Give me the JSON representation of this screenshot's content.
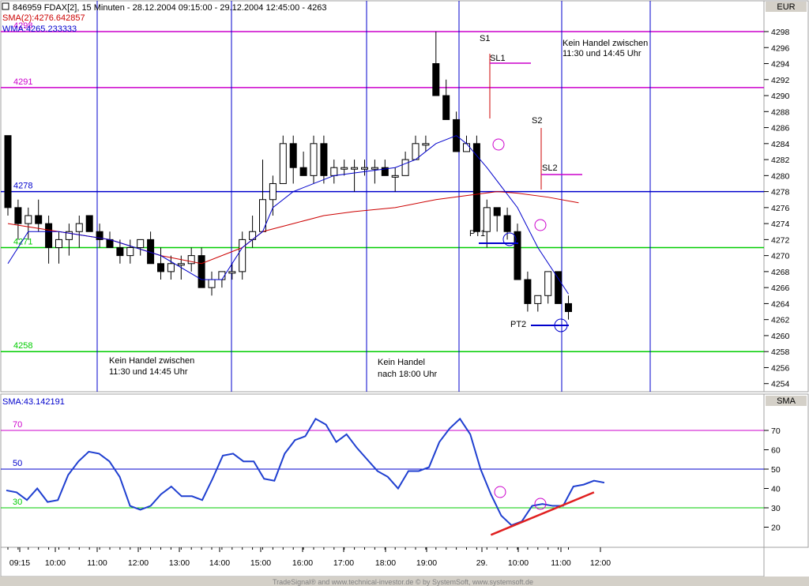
{
  "header": {
    "info": "846959  FDAX[2], 15 Minuten - 28.12.2004 09:15:00 - 29.12.2004 12:45:00 - 4263",
    "sma_line": "SMA(2):4276.642857",
    "wma_line": "WMA:4265.233333",
    "currency": "EUR"
  },
  "lower_panel": {
    "title": "SMA:43.142191",
    "right_label": "SMA"
  },
  "footer": "TradeSignal® and www.technical-investor.de © by SystemSoft, www.systemsoft.de",
  "colors": {
    "magenta": "#cc00cc",
    "blue": "#0000cc",
    "green": "#00cc00",
    "red": "#cc0000",
    "indicator": "#1f3fd0",
    "trend": "#e02020"
  },
  "chart_data": [
    {
      "type": "candlestick",
      "y_axis_ticks": [
        4254,
        4256,
        4258,
        4260,
        4262,
        4264,
        4266,
        4268,
        4270,
        4272,
        4274,
        4276,
        4278,
        4280,
        4282,
        4284,
        4286,
        4288,
        4290,
        4292,
        4294,
        4296,
        4298
      ],
      "ylim": [
        4253,
        4300
      ],
      "x_tick_labels": [
        "09:15",
        "10:00",
        "11:00",
        "12:00",
        "13:00",
        "14:00",
        "15:00",
        "16:00",
        "17:00",
        "18:00",
        "19:00",
        "29.",
        "10:00",
        "11:00",
        "12:00"
      ],
      "horizontal_levels": [
        {
          "value": 4298,
          "label": "4298",
          "color": "#cc00cc"
        },
        {
          "value": 4291,
          "label": "4291",
          "color": "#cc00cc"
        },
        {
          "value": 4278,
          "label": "4278",
          "color": "#0000cc"
        },
        {
          "value": 4271,
          "label": "4271",
          "color": "#00cc00"
        },
        {
          "value": 4258,
          "label": "4258",
          "color": "#00cc00"
        }
      ],
      "candles": [
        [
          4285,
          4285,
          4275,
          4276
        ],
        [
          4276,
          4277,
          4272,
          4274
        ],
        [
          4274,
          4276,
          4272,
          4275
        ],
        [
          4275,
          4277,
          4273,
          4274
        ],
        [
          4274,
          4275,
          4269,
          4271
        ],
        [
          4271,
          4273,
          4269,
          4272
        ],
        [
          4272,
          4274,
          4270,
          4273
        ],
        [
          4273,
          4275,
          4271,
          4274
        ],
        [
          4275,
          4275,
          4273,
          4273
        ],
        [
          4273,
          4274,
          4271,
          4272
        ],
        [
          4272,
          4273,
          4271,
          4271
        ],
        [
          4271,
          4272,
          4269,
          4270
        ],
        [
          4270,
          4272,
          4269,
          4271
        ],
        [
          4271,
          4272,
          4270,
          4272
        ],
        [
          4272,
          4273,
          4270,
          4269
        ],
        [
          4269,
          4271,
          4267,
          4268
        ],
        [
          4268,
          4270,
          4267,
          4269
        ],
        [
          4269,
          4270,
          4267,
          4269
        ],
        [
          4269,
          4271,
          4268,
          4270
        ],
        [
          4270,
          4271,
          4266,
          4266
        ],
        [
          4266,
          4268,
          4265,
          4267
        ],
        [
          4267,
          4268,
          4266,
          4268
        ],
        [
          4268,
          4269,
          4267,
          4268
        ],
        [
          4268,
          4273,
          4267,
          4272
        ],
        [
          4272,
          4275,
          4271,
          4273
        ],
        [
          4273,
          4282,
          4273,
          4277
        ],
        [
          4277,
          4280,
          4275,
          4279
        ],
        [
          4279,
          4285,
          4279,
          4284
        ],
        [
          4284,
          4285,
          4279,
          4281
        ],
        [
          4281,
          4283,
          4280,
          4280
        ],
        [
          4280,
          4285,
          4279,
          4284
        ],
        [
          4284,
          4285,
          4279,
          4280
        ],
        [
          4280,
          4282,
          4279,
          4281
        ],
        [
          4281,
          4282,
          4280,
          4281
        ],
        [
          4281,
          4282,
          4278,
          4281
        ],
        [
          4281,
          4282,
          4280,
          4281
        ],
        [
          4281,
          4282,
          4279,
          4281
        ],
        [
          4281,
          4282,
          4280,
          4280
        ],
        [
          4280,
          4281,
          4278,
          4280
        ],
        [
          4280,
          4283,
          4280,
          4282
        ],
        [
          4282,
          4285,
          4282,
          4284
        ],
        [
          4284,
          4285,
          4283,
          4284
        ],
        [
          4294,
          4298,
          4290,
          4290
        ],
        [
          4290,
          4292,
          4288,
          4287
        ],
        [
          4287,
          4288,
          4284,
          4283
        ],
        [
          4283,
          4285,
          4283,
          4284
        ],
        [
          4284,
          4285,
          4273,
          4273
        ],
        [
          4273,
          4277,
          4271,
          4276
        ],
        [
          4276,
          4276,
          4273,
          4275
        ],
        [
          4275,
          4276,
          4272,
          4273
        ],
        [
          4273,
          4274,
          4267,
          4267
        ],
        [
          4267,
          4268,
          4263,
          4264
        ],
        [
          4264,
          4265,
          4263,
          4265
        ],
        [
          4265,
          4268,
          4264,
          4268
        ],
        [
          4268,
          4268,
          4265,
          4264
        ],
        [
          4264,
          4265,
          4262,
          4263
        ]
      ],
      "sma": [
        [
          0,
          4274
        ],
        [
          5,
          4273
        ],
        [
          10,
          4272
        ],
        [
          15,
          4270
        ],
        [
          19,
          4269
        ],
        [
          23,
          4271
        ],
        [
          25,
          4273
        ],
        [
          28,
          4274
        ],
        [
          31,
          4275
        ],
        [
          34,
          4275.5
        ],
        [
          38,
          4276
        ],
        [
          42,
          4277
        ],
        [
          45,
          4277.5
        ],
        [
          48,
          4278
        ],
        [
          50,
          4277.8
        ],
        [
          53,
          4277.3
        ],
        [
          56,
          4276.6
        ]
      ],
      "wma": [
        [
          0,
          4269
        ],
        [
          2,
          4273
        ],
        [
          5,
          4273
        ],
        [
          10,
          4272
        ],
        [
          15,
          4270
        ],
        [
          19,
          4267
        ],
        [
          21,
          4267
        ],
        [
          23,
          4271
        ],
        [
          25,
          4273
        ],
        [
          26,
          4276
        ],
        [
          28,
          4278
        ],
        [
          32,
          4280
        ],
        [
          38,
          4281
        ],
        [
          40,
          4282
        ],
        [
          42,
          4284
        ],
        [
          44,
          4285
        ],
        [
          45,
          4284
        ],
        [
          47,
          4281
        ],
        [
          50,
          4276
        ],
        [
          52,
          4271
        ],
        [
          55,
          4265.2
        ]
      ],
      "annotations": [
        {
          "text": "S1",
          "kind": "signal"
        },
        {
          "text": "SL1",
          "kind": "stop"
        },
        {
          "text": "S2",
          "kind": "signal"
        },
        {
          "text": "SL2",
          "kind": "stop"
        },
        {
          "text": "PT1",
          "kind": "target"
        },
        {
          "text": "PT2",
          "kind": "target"
        },
        {
          "text": "Kein Handel zwischen",
          "kind": "note"
        },
        {
          "text": "11:30 und 14:45 Uhr",
          "kind": "note"
        },
        {
          "text": "Kein Handel zwischen",
          "kind": "note"
        },
        {
          "text": "11:30 und 14:45 Uhr",
          "kind": "note"
        },
        {
          "text": "Kein Handel",
          "kind": "note"
        },
        {
          "text": "nach 18:00 Uhr",
          "kind": "note"
        }
      ]
    },
    {
      "type": "line",
      "name": "SMA",
      "y_axis_ticks": [
        20,
        30,
        40,
        50,
        60,
        70
      ],
      "ylim": [
        10,
        80
      ],
      "horizontal_levels": [
        {
          "value": 70,
          "label": "70",
          "color": "#cc00cc"
        },
        {
          "value": 50,
          "label": "50",
          "color": "#0000cc"
        },
        {
          "value": 30,
          "label": "30",
          "color": "#00cc00"
        }
      ],
      "values": [
        39,
        38,
        34,
        40,
        33,
        34,
        47,
        54,
        59,
        58,
        54,
        46,
        31,
        29,
        31,
        37,
        41,
        36,
        36,
        34,
        45,
        57,
        58,
        54,
        54,
        45,
        44,
        58,
        65,
        67,
        76,
        73,
        64,
        68,
        61,
        55,
        49,
        46,
        40,
        49,
        49,
        51,
        64,
        71,
        76,
        68,
        50,
        37,
        26,
        21,
        23,
        31,
        32,
        31,
        31,
        41,
        42,
        44,
        43
      ],
      "trendline": [
        [
          47,
          16
        ],
        [
          57,
          38
        ]
      ],
      "markers": [
        38,
        32
      ]
    }
  ]
}
